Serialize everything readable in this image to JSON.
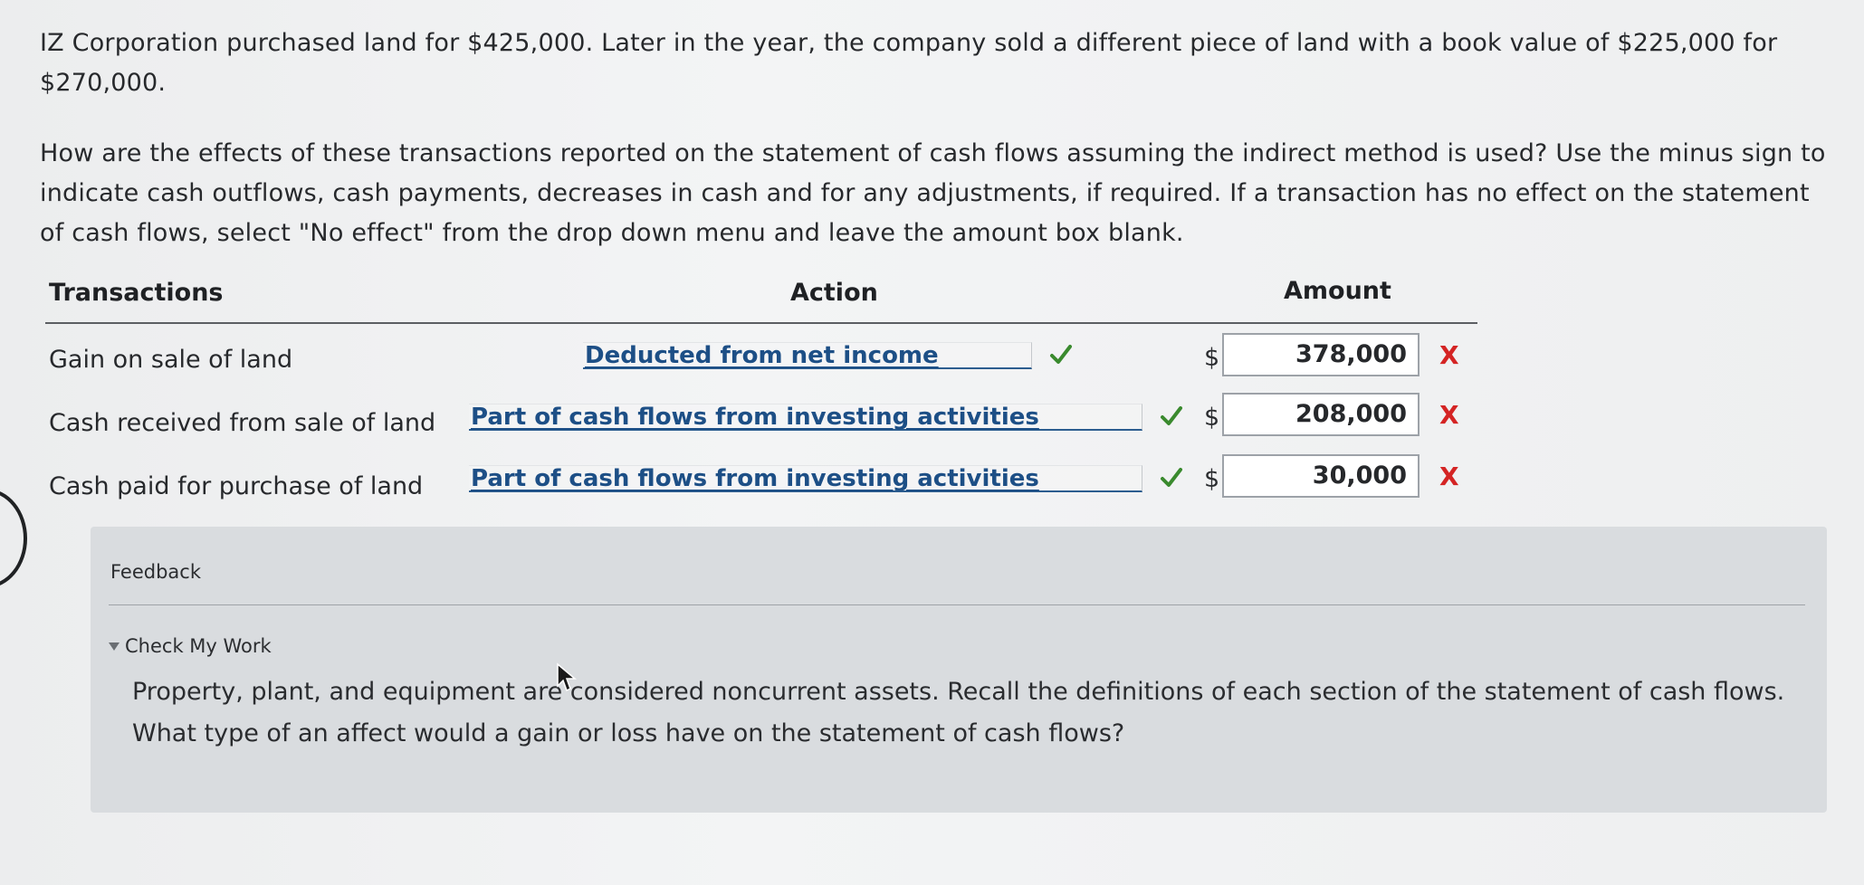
{
  "question": {
    "intro": "IZ Corporation purchased land for $425,000. Later in the year, the company sold a different piece of land with a book value of $225,000 for $270,000.",
    "instructions": "How are the effects of these transactions reported on the statement of cash flows assuming the indirect method is used? Use the minus sign to indicate cash outflows, cash payments, decreases in cash and for any adjustments, if required. If a transaction has no effect on the statement of cash flows, select \"No effect\" from the drop down menu and leave the amount box blank."
  },
  "table": {
    "headers": {
      "transactions": "Transactions",
      "action": "Action",
      "amount": "Amount"
    },
    "currency_symbol": "$",
    "rows": [
      {
        "transaction": "Gain on sale of land",
        "action": "Deducted from net income",
        "action_status": "correct",
        "amount": "378,000",
        "amount_status": "incorrect"
      },
      {
        "transaction": "Cash received from sale of land",
        "action": "Part of cash flows from investing activities",
        "action_status": "correct",
        "amount": "208,000",
        "amount_status": "incorrect"
      },
      {
        "transaction": "Cash paid for purchase of land",
        "action": "Part of cash flows from investing activities",
        "action_status": "correct",
        "amount": "30,000",
        "amount_status": "incorrect"
      }
    ],
    "incorrect_mark": "X"
  },
  "feedback": {
    "title": "Feedback",
    "check_my_work": "Check My Work",
    "hint": "Property, plant, and equipment are considered noncurrent assets. Recall the definitions of each section of the statement of cash flows. What type of an affect would a gain or loss have on the statement of cash flows?"
  },
  "colors": {
    "check": "#3a8a2e",
    "x": "#d42424",
    "link": "#1d4f86",
    "feedback_bg": "#d9dcdf"
  }
}
